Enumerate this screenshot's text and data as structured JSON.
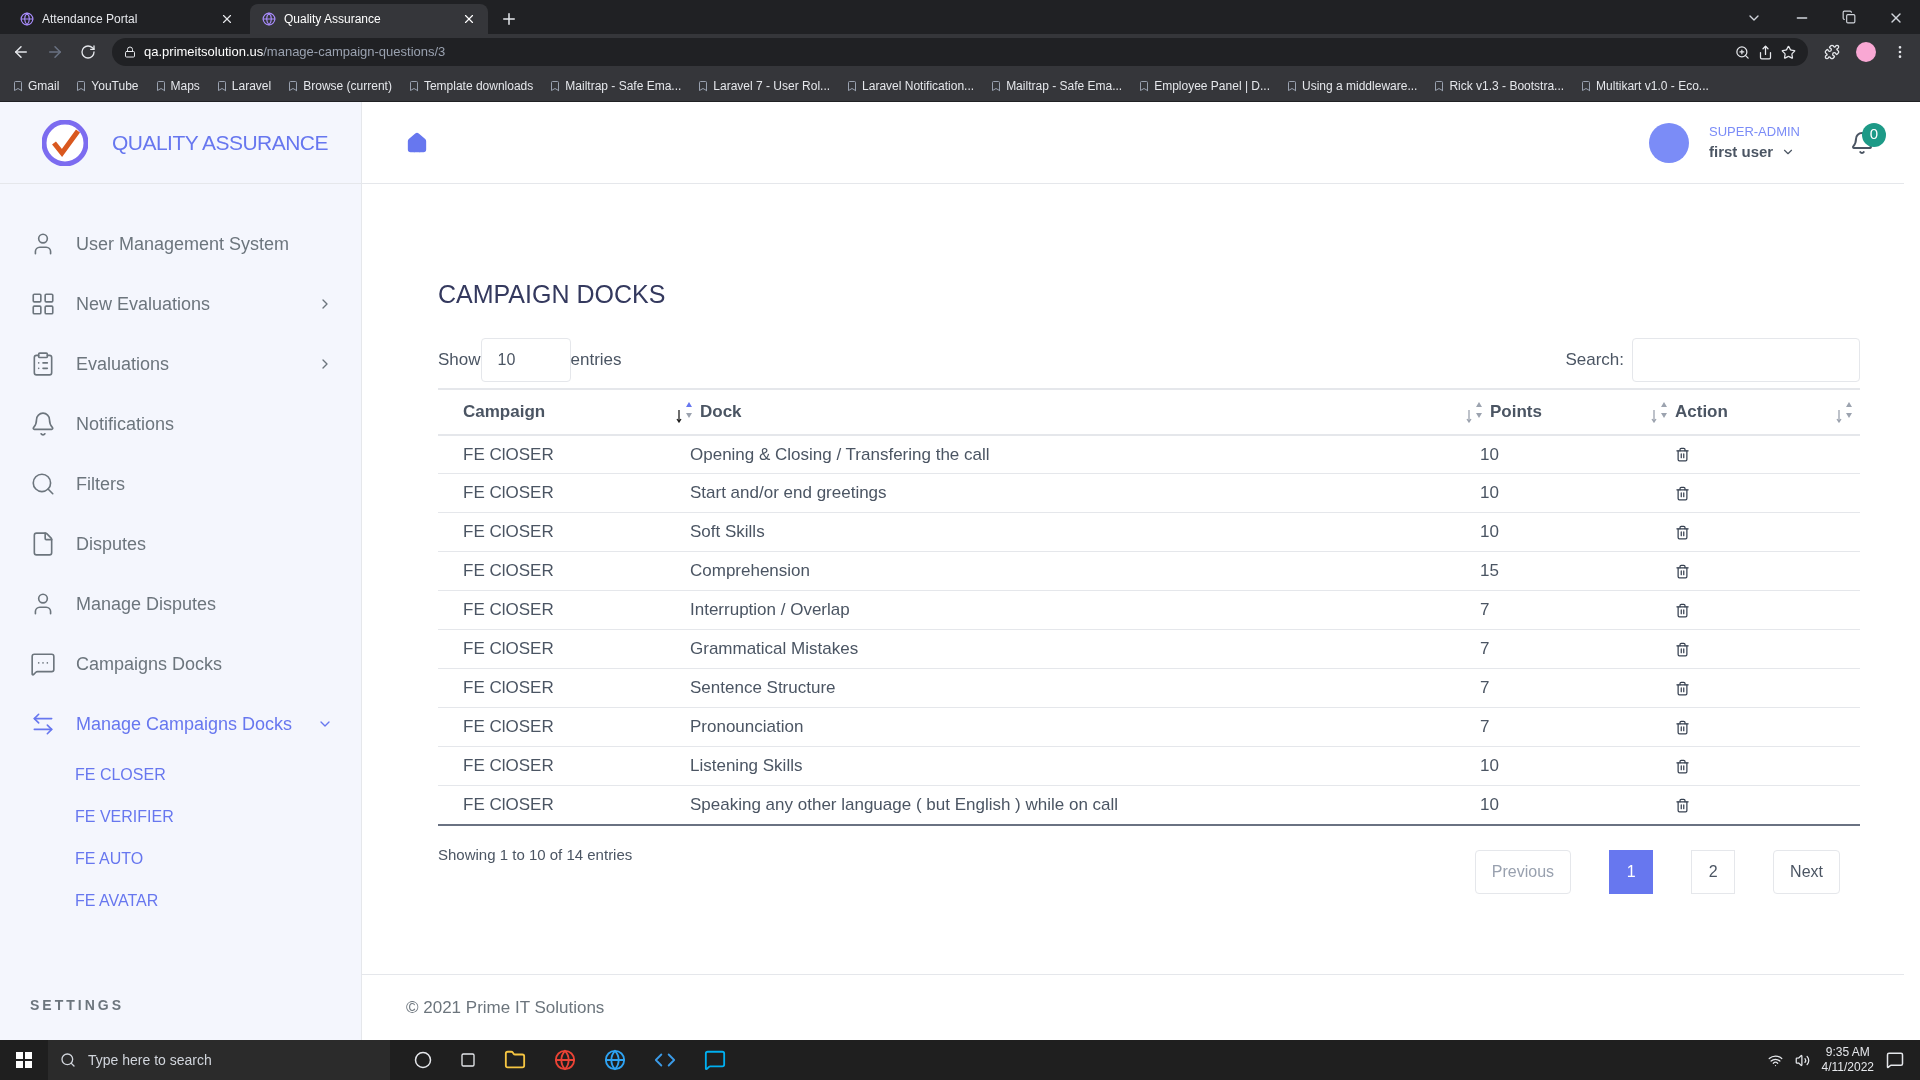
{
  "browser": {
    "tabs": [
      {
        "title": "Attendance Portal",
        "selected": false
      },
      {
        "title": "Quality Assurance",
        "selected": true
      }
    ],
    "url_host": "qa.primeitsolution.us",
    "url_path": "/manage-campaign-questions/3",
    "bookmarks": [
      "Gmail",
      "YouTube",
      "Maps",
      "Laravel",
      "Browse (current)",
      "Template downloads",
      "Mailtrap - Safe Ema...",
      "Laravel 7 - User Rol...",
      "Laravel Notification...",
      "Mailtrap - Safe Ema...",
      "Employee Panel | D...",
      "Using a middleware...",
      "Rick v1.3 - Bootstra...",
      "Multikart v1.0 - Eco..."
    ]
  },
  "brand": "QUALITY ASSURANCE",
  "user": {
    "role": "SUPER-ADMIN",
    "name": "first user",
    "notifications": "0"
  },
  "sidebar": {
    "items": [
      {
        "label": "User Management System",
        "kind": "link",
        "selected": false
      },
      {
        "label": "New Evaluations",
        "kind": "group",
        "expanded": false,
        "selected": false
      },
      {
        "label": "Evaluations",
        "kind": "group",
        "expanded": false,
        "selected": false
      },
      {
        "label": "Notifications",
        "kind": "link",
        "selected": false
      },
      {
        "label": "Filters",
        "kind": "link",
        "selected": false
      },
      {
        "label": "Disputes",
        "kind": "link",
        "selected": false
      },
      {
        "label": "Manage Disputes",
        "kind": "link",
        "selected": false
      },
      {
        "label": "Campaigns Docks",
        "kind": "link",
        "selected": false
      },
      {
        "label": "Manage Campaigns Docks",
        "kind": "group",
        "expanded": true,
        "selected": true,
        "children": [
          "FE CLOSER",
          "FE VERIFIER",
          "FE AUTO",
          "FE AVATAR"
        ]
      }
    ],
    "section": "SETTINGS"
  },
  "page": {
    "title": "CAMPAIGN DOCKS",
    "show_label": "Show",
    "page_size": "10",
    "entries_label": "entries",
    "search_label": "Search:",
    "table": {
      "columns": [
        {
          "label": "Campaign",
          "sorted": true
        },
        {
          "label": "Dock",
          "sorted": false
        },
        {
          "label": "Points",
          "sorted": false
        },
        {
          "label": "Action",
          "sorted": false
        }
      ],
      "rows": [
        [
          "FE ClOSER",
          "Opening & Closing / Transfering the call",
          "10"
        ],
        [
          "FE ClOSER",
          "Start and/or end greetings",
          "10"
        ],
        [
          "FE ClOSER",
          "Soft Skills",
          "10"
        ],
        [
          "FE ClOSER",
          "Comprehension",
          "15"
        ],
        [
          "FE ClOSER",
          "Interruption / Overlap",
          "7"
        ],
        [
          "FE ClOSER",
          "Grammatical Mistakes",
          "7"
        ],
        [
          "FE ClOSER",
          "Sentence Structure",
          "7"
        ],
        [
          "FE ClOSER",
          "Pronounciation",
          "7"
        ],
        [
          "FE ClOSER",
          "Listening Skills",
          "10"
        ],
        [
          "FE ClOSER",
          "Speaking any other language ( but English ) while on call",
          "10"
        ]
      ]
    },
    "info": "Showing 1 to 10 of 14 entries",
    "pagination": [
      {
        "label": "Previous",
        "kind": "nav",
        "disabled": true,
        "selected": false
      },
      {
        "label": "1",
        "kind": "page",
        "disabled": false,
        "selected": true
      },
      {
        "label": "2",
        "kind": "page",
        "disabled": false,
        "selected": false
      },
      {
        "label": "Next",
        "kind": "nav",
        "disabled": false,
        "selected": false
      }
    ]
  },
  "footer": "© 2021 Prime IT Solutions",
  "taskbar": {
    "search_placeholder": "Type here to search",
    "time": "9:35 AM",
    "date": "4/11/2022"
  }
}
